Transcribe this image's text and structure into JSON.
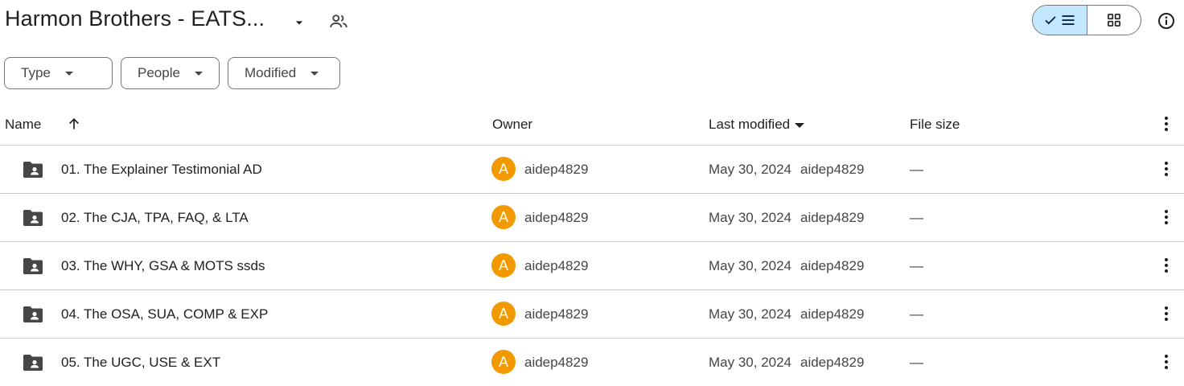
{
  "header": {
    "title": "Harmon Brothers - EATS...",
    "title_caret_icon": "arrow-drop-down-icon",
    "shared_icon": "people-icon",
    "view_list_icon": "check-list-icon",
    "view_grid_icon": "grid-icon",
    "info_icon": "info-icon",
    "accent_color": "#c2e7ff"
  },
  "filters": [
    {
      "label": "Type"
    },
    {
      "label": "People"
    },
    {
      "label": "Modified"
    }
  ],
  "table": {
    "columns": {
      "name": "Name",
      "owner": "Owner",
      "last_modified": "Last modified",
      "file_size": "File size"
    },
    "rows": [
      {
        "name": "01. The Explainer Testimonial AD",
        "avatar": "A",
        "owner": "aidep4829",
        "modified": "May 30, 2024",
        "modified_by": "aidep4829",
        "size": "—"
      },
      {
        "name": "02. The CJA, TPA, FAQ, & LTA",
        "avatar": "A",
        "owner": "aidep4829",
        "modified": "May 30, 2024",
        "modified_by": "aidep4829",
        "size": "—"
      },
      {
        "name": "03. The WHY, GSA & MOTS ssds",
        "avatar": "A",
        "owner": "aidep4829",
        "modified": "May 30, 2024",
        "modified_by": "aidep4829",
        "size": "—"
      },
      {
        "name": "04. The OSA, SUA, COMP & EXP",
        "avatar": "A",
        "owner": "aidep4829",
        "modified": "May 30, 2024",
        "modified_by": "aidep4829",
        "size": "—"
      },
      {
        "name": "05. The UGC, USE & EXT",
        "avatar": "A",
        "owner": "aidep4829",
        "modified": "May 30, 2024",
        "modified_by": "aidep4829",
        "size": "—"
      }
    ],
    "avatar_color": "#f29900"
  }
}
